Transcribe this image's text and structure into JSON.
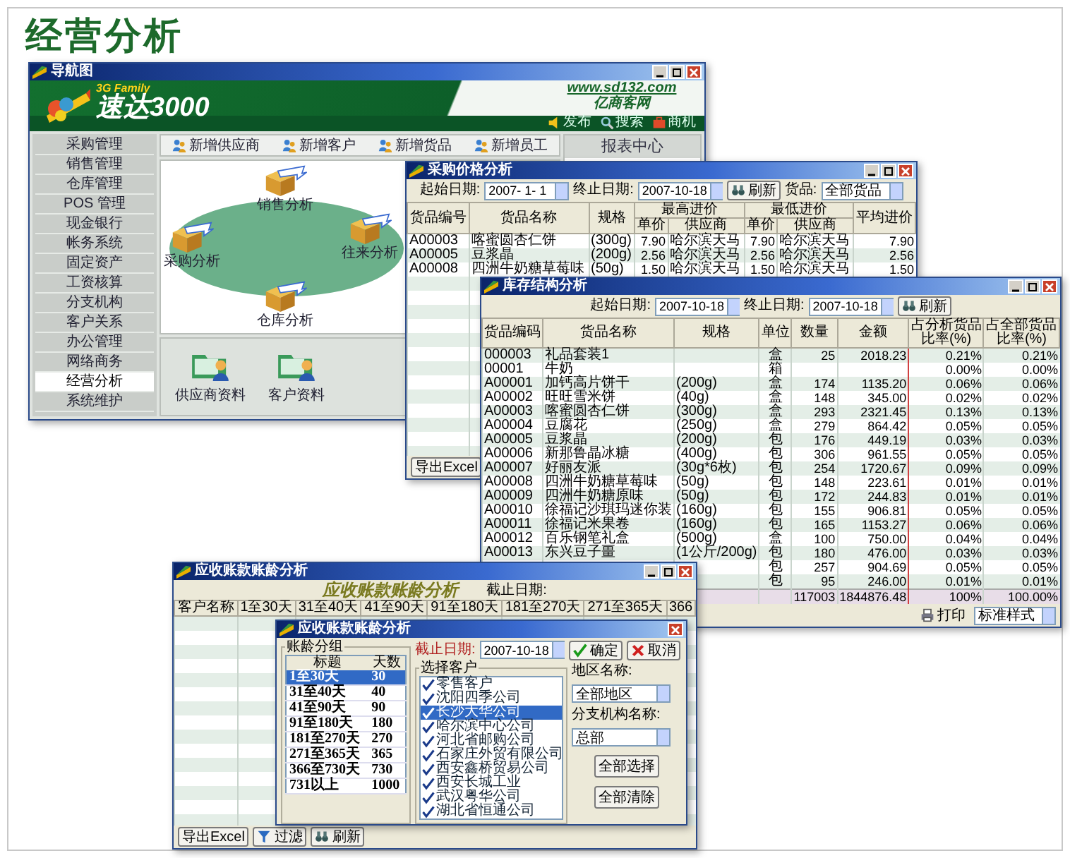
{
  "page_title": "经营分析",
  "main_window": {
    "title": "导航图",
    "brand_tag": "3G Family",
    "brand": "速达3000",
    "site_url": "www.sd132.com",
    "site_name": "亿商客网",
    "header_links": [
      {
        "label": "发布"
      },
      {
        "label": "搜索"
      },
      {
        "label": "商机"
      }
    ],
    "sidebar": {
      "items": [
        {
          "label": "采购管理",
          "selected": false
        },
        {
          "label": "销售管理",
          "selected": false
        },
        {
          "label": "仓库管理",
          "selected": false
        },
        {
          "label": "POS 管理",
          "selected": false
        },
        {
          "label": "现金银行",
          "selected": false
        },
        {
          "label": "帐务系统",
          "selected": false
        },
        {
          "label": "固定资产",
          "selected": false
        },
        {
          "label": "工资核算",
          "selected": false
        },
        {
          "label": "分支机构",
          "selected": false
        },
        {
          "label": "客户关系",
          "selected": false
        },
        {
          "label": "办公管理",
          "selected": false
        },
        {
          "label": "网络商务",
          "selected": false
        },
        {
          "label": "经营分析",
          "selected": true
        },
        {
          "label": "系统维护",
          "selected": false
        }
      ]
    },
    "toolbar": [
      {
        "label": "新增供应商"
      },
      {
        "label": "新增客户"
      },
      {
        "label": "新增货品"
      },
      {
        "label": "新增员工"
      }
    ],
    "diagram": {
      "nodes": [
        {
          "label": "销售分析"
        },
        {
          "label": "采购分析"
        },
        {
          "label": "往来分析"
        },
        {
          "label": "仓库分析"
        }
      ]
    },
    "shortcuts": [
      {
        "label": "供应商资料"
      },
      {
        "label": "客户资料"
      }
    ],
    "report_panel": {
      "title": "报表中心"
    }
  },
  "purchase_window": {
    "title": "采购价格分析",
    "filters": [
      {
        "label": "起始日期:",
        "value": "2007- 1- 1"
      },
      {
        "label": "终止日期:",
        "value": "2007-10-18"
      }
    ],
    "refresh": "刷新",
    "goods_filter": {
      "label": "货品:",
      "value": "全部货品"
    },
    "header_rows": [
      [
        {
          "label": "货品编号",
          "rowspan": 2
        },
        {
          "label": "货品名称",
          "rowspan": 2
        },
        {
          "label": "规格",
          "rowspan": 2
        },
        {
          "label": "最高进价",
          "colspan": 2
        },
        {
          "label": "最低进价",
          "colspan": 2
        },
        {
          "label": "平均进价",
          "rowspan": 2
        }
      ],
      [
        {
          "label": "单价"
        },
        {
          "label": "供应商"
        },
        {
          "label": "单价"
        },
        {
          "label": "供应商"
        }
      ]
    ],
    "rows": [
      [
        "A00003",
        "喀蜜圆杏仁饼",
        "(300g)",
        "7.90",
        "哈尔滨天马",
        "7.90",
        "哈尔滨天马",
        "7.90"
      ],
      [
        "A00005",
        "豆浆晶",
        "(200g)",
        "2.56",
        "哈尔滨天马",
        "2.56",
        "哈尔滨天马",
        "2.56"
      ],
      [
        "A00008",
        "四洲牛奶糖草莓味",
        "(50g)",
        "1.50",
        "哈尔滨天马",
        "1.50",
        "哈尔滨天马",
        "1.50"
      ]
    ],
    "export_button": "导出Excel"
  },
  "inventory_window": {
    "title": "库存结构分析",
    "filters": [
      {
        "label": "起始日期:",
        "value": "2007-10-18"
      },
      {
        "label": "终止日期:",
        "value": "2007-10-18"
      }
    ],
    "refresh": "刷新",
    "columns": [
      "货品编码",
      "货品名称",
      "规格",
      "单位",
      "数量",
      "金额",
      "占分析货品比率(%)",
      "占全部货品比率(%)"
    ],
    "rows": [
      {
        "code": "000003",
        "name": "礼品套装1",
        "unit": "盒",
        "qty": "25",
        "amount": "2018.23",
        "ratio_analysis": "0.21%",
        "ratio_all": "0.21%"
      },
      {
        "code": "00001",
        "name": "牛奶",
        "unit": "箱",
        "ratio_analysis": "0.00%",
        "ratio_all": "0.00%"
      },
      {
        "code": "A00001",
        "name": "加钙高片饼干",
        "spec": "(200g)",
        "unit": "盒",
        "qty": "174",
        "amount": "1135.20",
        "ratio_analysis": "0.06%",
        "ratio_all": "0.06%"
      },
      {
        "code": "A00002",
        "name": "旺旺雪米饼",
        "spec": "(40g)",
        "unit": "盒",
        "qty": "148",
        "amount": "345.00",
        "ratio_analysis": "0.02%",
        "ratio_all": "0.02%"
      },
      {
        "code": "A00003",
        "name": "喀蜜圆杏仁饼",
        "spec": "(300g)",
        "unit": "盒",
        "qty": "293",
        "amount": "2321.45",
        "ratio_analysis": "0.13%",
        "ratio_all": "0.13%"
      },
      {
        "code": "A00004",
        "name": "豆腐花",
        "spec": "(250g)",
        "unit": "盒",
        "qty": "279",
        "amount": "864.42",
        "ratio_analysis": "0.05%",
        "ratio_all": "0.05%"
      },
      {
        "code": "A00005",
        "name": "豆浆晶",
        "spec": "(200g)",
        "unit": "包",
        "qty": "176",
        "amount": "449.19",
        "ratio_analysis": "0.03%",
        "ratio_all": "0.03%"
      },
      {
        "code": "A00006",
        "name": "新那鲁晶冰糖",
        "spec": "(400g)",
        "unit": "包",
        "qty": "306",
        "amount": "961.55",
        "ratio_analysis": "0.05%",
        "ratio_all": "0.05%"
      },
      {
        "code": "A00007",
        "name": "好丽友派",
        "spec": "(30g*6枚)",
        "unit": "包",
        "qty": "254",
        "amount": "1720.67",
        "ratio_analysis": "0.09%",
        "ratio_all": "0.09%"
      },
      {
        "code": "A00008",
        "name": "四洲牛奶糖草莓味",
        "spec": "(50g)",
        "unit": "包",
        "qty": "148",
        "amount": "223.61",
        "ratio_analysis": "0.01%",
        "ratio_all": "0.01%"
      },
      {
        "code": "A00009",
        "name": "四洲牛奶糖原味",
        "spec": "(50g)",
        "unit": "包",
        "qty": "172",
        "amount": "244.83",
        "ratio_analysis": "0.01%",
        "ratio_all": "0.01%"
      },
      {
        "code": "A00010",
        "name": "徐福记沙琪玛迷你装",
        "spec": "(160g)",
        "unit": "包",
        "qty": "155",
        "amount": "906.81",
        "ratio_analysis": "0.05%",
        "ratio_all": "0.05%"
      },
      {
        "code": "A00011",
        "name": "徐福记米果卷",
        "spec": "(160g)",
        "unit": "包",
        "qty": "165",
        "amount": "1153.27",
        "ratio_analysis": "0.06%",
        "ratio_all": "0.06%"
      },
      {
        "code": "A00012",
        "name": "百乐钢笔礼盒",
        "spec": "(500g)",
        "unit": "盒",
        "qty": "100",
        "amount": "750.00",
        "ratio_analysis": "0.04%",
        "ratio_all": "0.04%"
      },
      {
        "code": "A00013",
        "name": "东兴豆子畺",
        "spec": "(1公斤/200g)",
        "unit": "包",
        "qty": "180",
        "amount": "476.00",
        "ratio_analysis": "0.03%",
        "ratio_all": "0.03%"
      },
      {
        "unit": "包",
        "qty": "257",
        "amount": "904.69",
        "ratio_analysis": "0.05%",
        "ratio_all": "0.05%"
      },
      {
        "unit": "包",
        "qty": "95",
        "amount": "246.00",
        "ratio_analysis": "0.01%",
        "ratio_all": "0.01%"
      }
    ],
    "totals": {
      "qty": "117003",
      "amount": "1844876.48",
      "ratio_analysis": "100%",
      "ratio_all": "100.00%"
    },
    "print_button": "打印",
    "style_select": "标准样式"
  },
  "aging_window": {
    "title": "应收账款账龄分析",
    "heading": "应收账款账龄分析",
    "cutoff_label": "截止日期:",
    "columns": [
      "客户名称",
      "1至30天",
      "31至40天",
      "41至90天",
      "91至180天",
      "181至270天",
      "271至365天",
      "366"
    ],
    "buttons": [
      {
        "label": "导出Excel"
      },
      {
        "label": "过滤"
      },
      {
        "label": "刷新"
      }
    ],
    "dialog": {
      "title": "应收账款账龄分析",
      "group_label": "账龄分组",
      "group_columns": [
        "标题",
        "天数"
      ],
      "age_groups": [
        {
          "title": "1至30天",
          "days": "30",
          "selected": true
        },
        {
          "title": "31至40天",
          "days": "40",
          "selected": false
        },
        {
          "title": "41至90天",
          "days": "90",
          "selected": false
        },
        {
          "title": "91至180天",
          "days": "180",
          "selected": false
        },
        {
          "title": "181至270天",
          "days": "270",
          "selected": false
        },
        {
          "title": "271至365天",
          "days": "365",
          "selected": false
        },
        {
          "title": "366至730天",
          "days": "730",
          "selected": false
        },
        {
          "title": "731以上",
          "days": "1000",
          "selected": false
        }
      ],
      "cutoff_label": "截止日期:",
      "cutoff_value": "2007-10-18",
      "ok": "确定",
      "cancel": "取消",
      "customer_label": "选择客户",
      "customers": [
        {
          "name": "零售客户",
          "checked": true,
          "selected": false
        },
        {
          "name": "沈阳四季公司",
          "checked": true,
          "selected": false
        },
        {
          "name": "长沙大华公司",
          "checked": true,
          "selected": true
        },
        {
          "name": "哈尔滨中心公司",
          "checked": true,
          "selected": false
        },
        {
          "name": "河北省邮购公司",
          "checked": true,
          "selected": false
        },
        {
          "name": "石家庄外贸有限公司",
          "checked": true,
          "selected": false
        },
        {
          "name": "西安鑫桥贸易公司",
          "checked": true,
          "selected": false
        },
        {
          "name": "西安长城工业",
          "checked": true,
          "selected": false
        },
        {
          "name": "武汉粤华公司",
          "checked": true,
          "selected": false
        },
        {
          "name": "湖北省恒通公司",
          "checked": true,
          "selected": false
        }
      ],
      "region_label": "地区名称:",
      "region_value": "全部地区",
      "branch_label": "分支机构名称:",
      "branch_value": "总部",
      "select_all": "全部选择",
      "clear_all": "全部清除"
    }
  }
}
